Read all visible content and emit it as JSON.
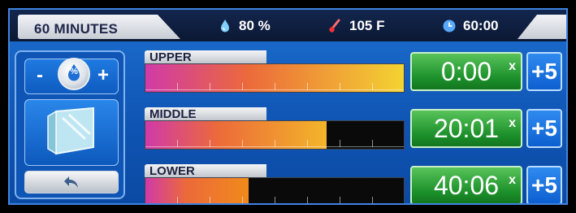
{
  "header": {
    "duration": "60 MINUTES",
    "humidity": "80 %",
    "temperature": "105 F",
    "time_remaining": "60:00"
  },
  "left_panel": {
    "minus_label": "-",
    "plus_label": "+",
    "humidity_knob_glyph": "%",
    "chamber_icon": "cabinet-icon",
    "back_icon": "back-arrow-icon"
  },
  "shelves": [
    {
      "name": "UPPER",
      "timer": "0:00",
      "close_glyph": "x",
      "add_label": "+5",
      "progress_percent": 100,
      "fill_start_color": "#d03aa8",
      "fill_end_color": "#f3d332"
    },
    {
      "name": "MIDDLE",
      "timer": "20:01",
      "close_glyph": "x",
      "add_label": "+5",
      "progress_percent": 70,
      "fill_start_color": "#d03aa8",
      "fill_end_color": "#f3b52a"
    },
    {
      "name": "LOWER",
      "timer": "40:06",
      "close_glyph": "x",
      "add_label": "+5",
      "progress_percent": 40,
      "fill_start_color": "#d03aa8",
      "fill_end_color": "#f08a1b"
    }
  ],
  "colors": {
    "screen_blue": "#0f54b3",
    "timer_green": "#1b8f2a",
    "topbar_dark": "#0b1833"
  }
}
